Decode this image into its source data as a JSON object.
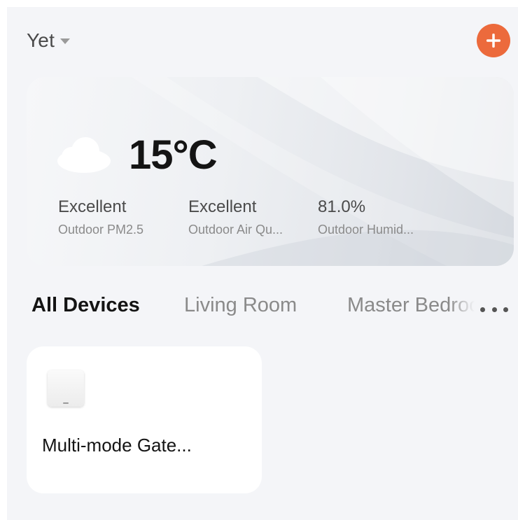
{
  "header": {
    "home_name": "Yet",
    "add_button_label": "+"
  },
  "weather": {
    "icon": "cloud-icon",
    "temperature": "15°C",
    "stats": [
      {
        "value": "Excellent",
        "label": "Outdoor PM2.5"
      },
      {
        "value": "Excellent",
        "label": "Outdoor Air Qu..."
      },
      {
        "value": "81.0%",
        "label": "Outdoor Humid..."
      }
    ]
  },
  "tabs": {
    "items": [
      {
        "label": "All Devices",
        "active": true
      },
      {
        "label": "Living Room",
        "active": false
      },
      {
        "label": "Master Bedroom",
        "active": false
      }
    ],
    "more_icon": "more-horizontal-icon"
  },
  "devices": [
    {
      "name": "Multi-mode Gate...",
      "icon": "gateway-device-icon"
    }
  ],
  "colors": {
    "accent": "#ec6a3c",
    "background": "#f4f5f8",
    "card": "#ffffff"
  }
}
